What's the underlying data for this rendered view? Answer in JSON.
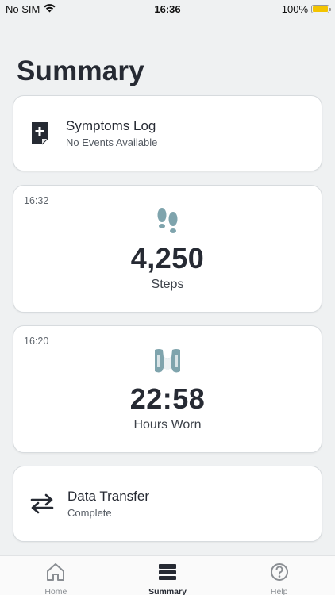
{
  "status_bar": {
    "carrier": "No SIM",
    "time": "16:36",
    "battery": "100%",
    "battery_level": 1.0,
    "battery_color": "#f3c400"
  },
  "page": {
    "title": "Summary"
  },
  "symptoms_card": {
    "title": "Symptoms Log",
    "subtitle": "No Events Available",
    "icon": "document-plus-icon"
  },
  "steps_card": {
    "time": "16:32",
    "value": "4,250",
    "label": "Steps",
    "icon": "footprints-icon",
    "icon_color": "#7fa4ad"
  },
  "hours_card": {
    "time": "16:20",
    "value": "22:58",
    "label": "Hours Worn",
    "icon": "brace-vest-icon",
    "icon_color": "#7fa4ad"
  },
  "transfer_card": {
    "title": "Data Transfer",
    "subtitle": "Complete",
    "icon": "transfer-arrows-icon"
  },
  "tab_bar": {
    "tabs": [
      {
        "label": "Home",
        "icon": "home-icon",
        "active": false
      },
      {
        "label": "Summary",
        "icon": "summary-icon",
        "active": true
      },
      {
        "label": "Help",
        "icon": "help-icon",
        "active": false
      }
    ]
  }
}
